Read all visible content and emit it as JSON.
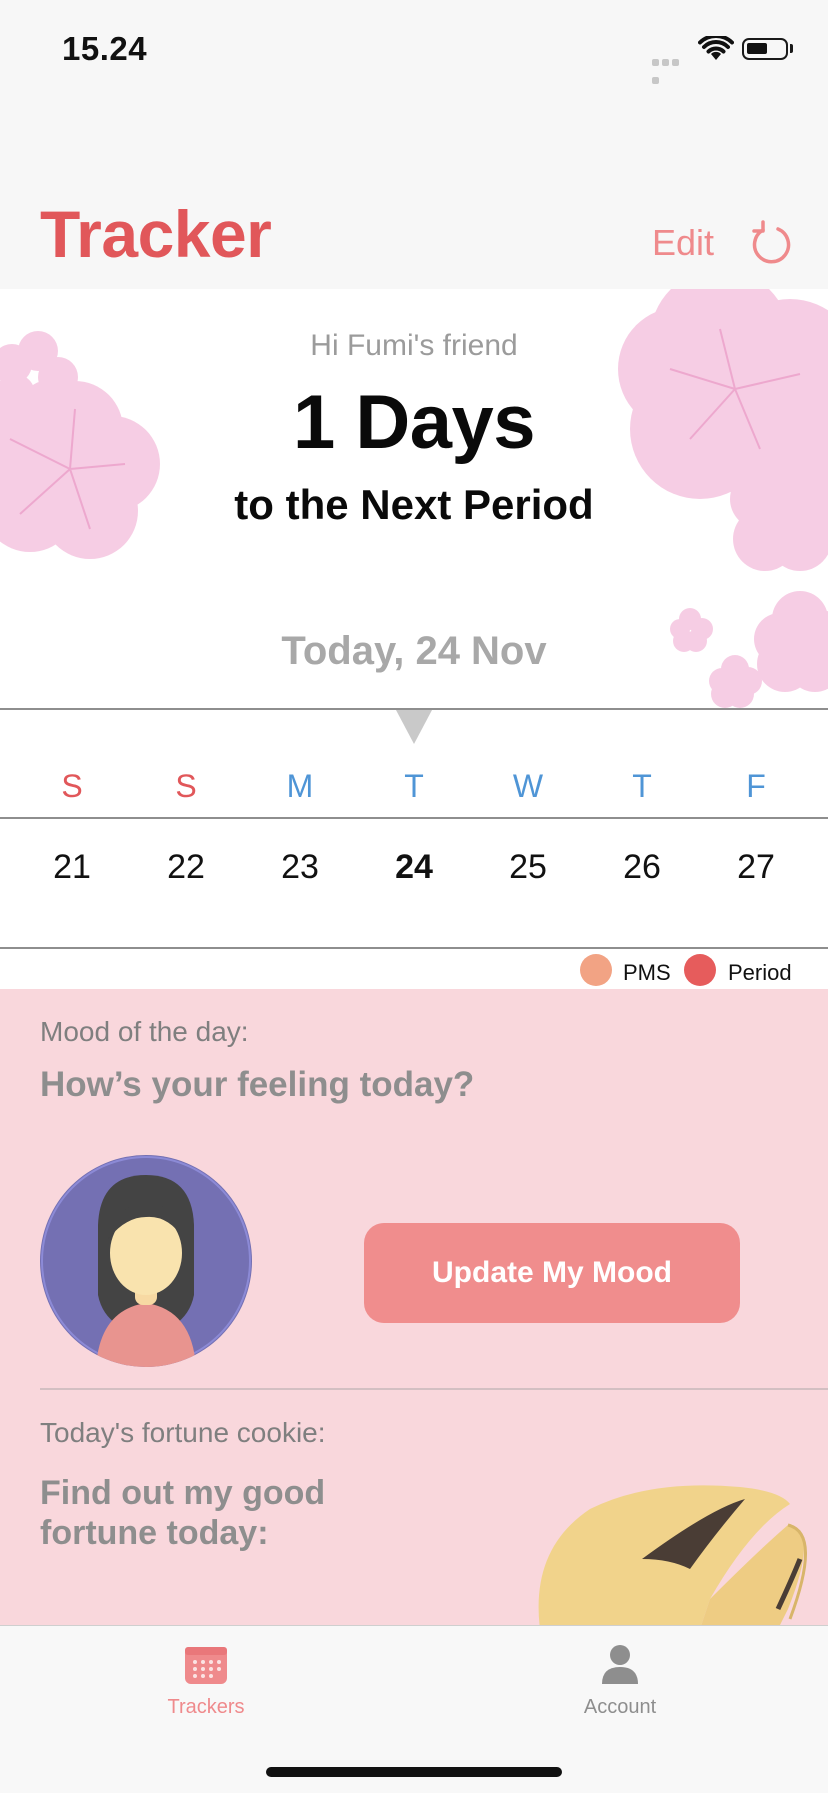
{
  "status_bar": {
    "time": "15.24",
    "wifi_icon": "wifi-icon",
    "battery_icon": "battery-icon",
    "battery_level": 0.5
  },
  "nav": {
    "title": "Tracker",
    "edit_label": "Edit",
    "refresh_icon": "refresh-icon"
  },
  "hero": {
    "greeting": "Hi Fumi's friend",
    "days_count": "1 Days",
    "days_caption": "to the Next Period",
    "today_label": "Today, 24 Nov"
  },
  "calendar": {
    "weekdays": [
      "S",
      "S",
      "M",
      "T",
      "W",
      "T",
      "F"
    ],
    "dates": [
      "21",
      "22",
      "23",
      "24",
      "25",
      "26",
      "27"
    ],
    "current_index": 3,
    "weekend_color": "#e1575a",
    "weekday_color": "#4f95d6"
  },
  "legend": [
    {
      "label": "PMS",
      "color": "#f2a384"
    },
    {
      "label": "Period",
      "color": "#e65c5c"
    }
  ],
  "mood": {
    "label": "Mood of the day:",
    "question": "How’s your feeling today?",
    "button_label": "Update My Mood"
  },
  "fortune": {
    "label": "Today's fortune cookie:",
    "question": "Find out my good fortune today:"
  },
  "tabbar": {
    "items": [
      {
        "label": "Trackers",
        "icon": "calendar-icon",
        "active": true
      },
      {
        "label": "Account",
        "icon": "person-icon",
        "active": false
      }
    ],
    "active_color": "#ef8a8c",
    "inactive_color": "#8e8e8e"
  },
  "colors": {
    "accent": "#e1575a",
    "pink_bg": "#f9d7dc",
    "button": "#f08d8d"
  }
}
